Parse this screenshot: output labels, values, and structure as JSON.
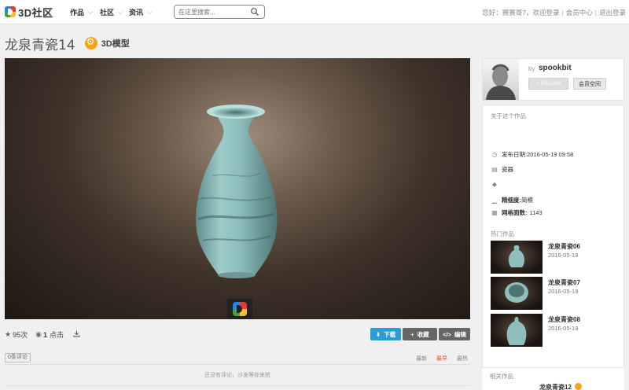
{
  "header": {
    "logo_text": "3D社区",
    "nav": [
      {
        "label": "作品"
      },
      {
        "label": "社区"
      },
      {
        "label": "资讯"
      }
    ],
    "search_placeholder": "在这里搜索...",
    "user": {
      "greeting": "您好：赛赛哥7，欢迎登录",
      "member_center": "会员中心",
      "logout": "退出登录",
      "separator": "|"
    }
  },
  "page": {
    "title": "龙泉青瓷14",
    "model_badge": "3D模型"
  },
  "stats": {
    "views": "95次",
    "likes_count": "1",
    "likes_label": "点击"
  },
  "actions": {
    "download": "下载",
    "collect": "收藏",
    "edit": "编辑"
  },
  "comments": {
    "count_tag": "0条评论",
    "sort": {
      "latest": "最新",
      "top": "最早",
      "hot": "最热"
    },
    "empty": "还没有评论，沙发等你来抢"
  },
  "author": {
    "by": "by",
    "name": "spookbit",
    "follow": "FOLLOW",
    "space": "会员空间"
  },
  "info": {
    "about": "关于这个作品",
    "publish_date": "发布日期:2016-05-19 09:58",
    "category": "瓷器",
    "precision_label": "精细度:",
    "precision_value": "简模",
    "mesh_label": "网格面数:",
    "mesh_value": "1143"
  },
  "hot": {
    "title": "热门作品",
    "items": [
      {
        "name": "龙泉青瓷06",
        "date": "2016-05-19"
      },
      {
        "name": "龙泉青瓷07",
        "date": "2016-05-19"
      },
      {
        "name": "龙泉青瓷08",
        "date": "2016-05-19"
      }
    ]
  },
  "related": {
    "title": "相关作品",
    "item_name": "龙泉青瓷12"
  },
  "colors": {
    "accent_blue": "#2a9fd6",
    "badge_orange": "#f7a21b",
    "celadon": "#8fbfbd"
  }
}
